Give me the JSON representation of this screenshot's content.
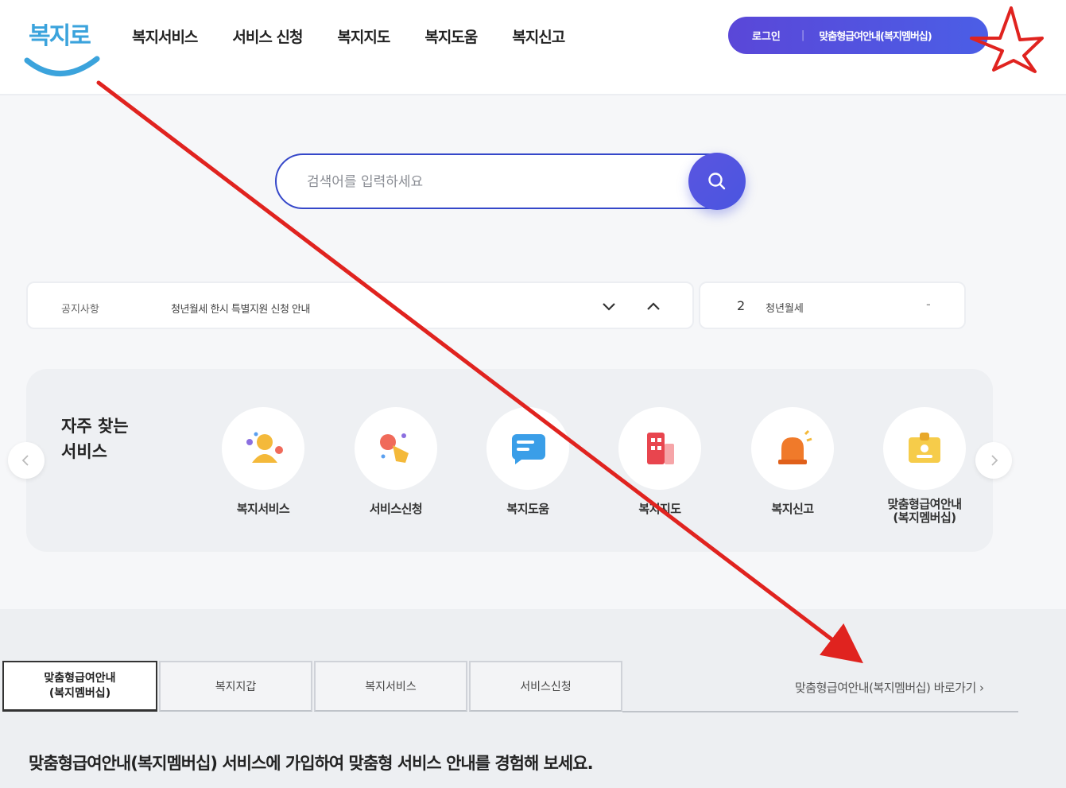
{
  "header": {
    "logo_text": "복지로",
    "nav": [
      "복지서비스",
      "서비스 신청",
      "복지지도",
      "복지도움",
      "복지신고"
    ],
    "login_label": "로그인",
    "separator": "|",
    "membership_label": "맞춤형급여안내(복지멤버십)"
  },
  "search": {
    "placeholder": "검색어를 입력하세요"
  },
  "notice": {
    "label": "공지사항",
    "text": "청년월세 한시 특별지원 신청 안내"
  },
  "ranking": {
    "number": "2",
    "text": "청년월세",
    "change": "-"
  },
  "frequent": {
    "title_line1": "자주 찾는",
    "title_line2": "서비스",
    "items": [
      {
        "label": "복지서비스",
        "icon": "person-icon"
      },
      {
        "label": "서비스신청",
        "icon": "hand-click-icon"
      },
      {
        "label": "복지도움",
        "icon": "message-icon"
      },
      {
        "label": "복지지도",
        "icon": "building-icon"
      },
      {
        "label": "복지신고",
        "icon": "alarm-icon"
      },
      {
        "label_line1": "맞춤형급여안내",
        "label_line2": "(복지멤버십)",
        "icon": "id-card-icon"
      }
    ]
  },
  "tabs": {
    "items": [
      {
        "line1": "맞춤형급여안내",
        "line2": "(복지멤버십)"
      },
      {
        "label": "복지지갑"
      },
      {
        "label": "복지서비스"
      },
      {
        "label": "서비스신청"
      }
    ],
    "shortcut": "맞춤형급여안내(복지멤버십) 바로가기 ›",
    "description": "맞춤형급여안내(복지멤버십) 서비스에 가입하여 맞춤형 서비스 안내를 경험해 보세요."
  },
  "colors": {
    "primary": "#4b52e0",
    "logo_blue": "#3ba3dc",
    "annotation_red": "#e0231f"
  }
}
